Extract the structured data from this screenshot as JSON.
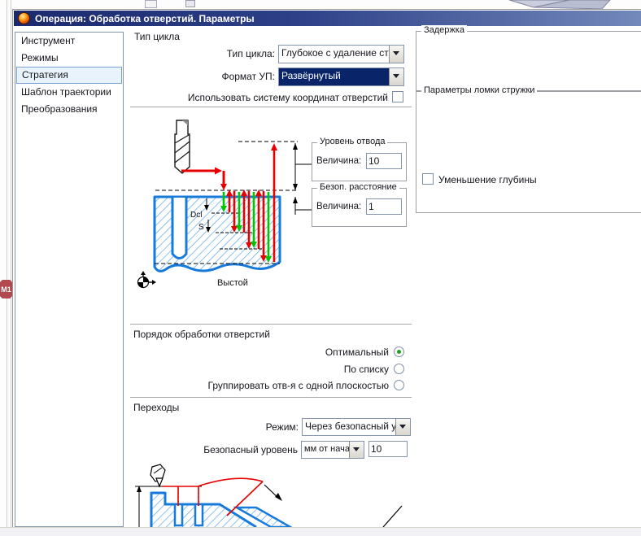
{
  "window": {
    "title": "Операция: Обработка отверстий. Параметры"
  },
  "sidebar": {
    "items": [
      {
        "label": "Инструмент",
        "selected": false
      },
      {
        "label": "Режимы",
        "selected": false
      },
      {
        "label": "Стратегия",
        "selected": true
      },
      {
        "label": "Шаблон траектории",
        "selected": false
      },
      {
        "label": "Преобразования",
        "selected": false
      }
    ]
  },
  "cycle": {
    "title": "Тип цикла",
    "type_label": "Тип цикла:",
    "type_value": "Глубокое с удаление стру",
    "format_label": "Формат УП:",
    "format_value": "Развёрнутый",
    "use_cs_label": "Использовать систему координат отверстий",
    "use_cs_checked": false
  },
  "levels": {
    "retract_title": "Уровень отвода",
    "retract_label": "Величина:",
    "retract_value": "10",
    "safe_title": "Безоп. расстояние",
    "safe_label": "Величина:",
    "safe_value": "1",
    "dcl": "Dcl",
    "s": "S",
    "dwell_label": "Выстой"
  },
  "order": {
    "title": "Порядок обработки отверстий",
    "options": [
      {
        "label": "Оптимальный",
        "selected": true
      },
      {
        "label": "По списку",
        "selected": false
      },
      {
        "label": "Группировать отв-я с одной плоскостью",
        "selected": false
      }
    ]
  },
  "transitions": {
    "title": "Переходы",
    "mode_label": "Режим:",
    "mode_value": "Через безопасный уро",
    "safe_label": "Безопасный уровень",
    "safe_unit": "мм от начал",
    "safe_value": "10"
  },
  "right": {
    "delay_title": "Задержка",
    "chip_title": "Параметры ломки стружки",
    "reduce_label": "Уменьшение глубины",
    "reduce_checked": false
  },
  "edge_badge": "М1",
  "colors": {
    "titlebar_left": "#1b2a6e",
    "titlebar_right": "#7389bb",
    "selection": "#0a246a",
    "sidebar_selected_bg": "#e9f3fc",
    "sidebar_selected_border": "#7aa2d4",
    "diagram_red": "#e80000",
    "diagram_green": "#00c400",
    "diagram_blue": "#167adb"
  }
}
